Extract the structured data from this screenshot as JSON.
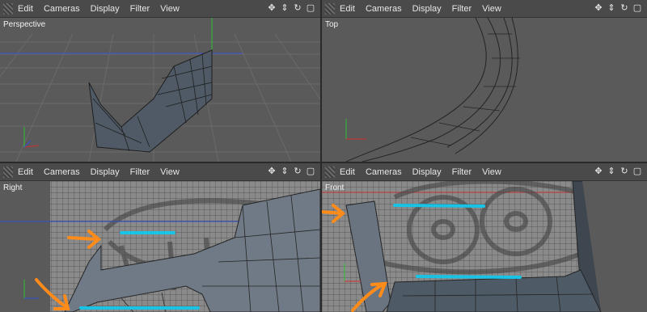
{
  "menu": [
    "Edit",
    "Cameras",
    "Display",
    "Filter",
    "View"
  ],
  "viewports": {
    "perspective": {
      "label": "Perspective"
    },
    "top": {
      "label": "Top"
    },
    "right": {
      "label": "Right"
    },
    "front": {
      "label": "Front"
    }
  },
  "nav_icons": [
    "move-icon",
    "zoom-icon",
    "rotate-icon",
    "maximize-icon"
  ],
  "axes": {
    "x_color": "#d03030",
    "y_color": "#30c030",
    "z_color": "#3050d0"
  },
  "annotation_colors": {
    "arrow": "#ff8c1a",
    "line": "#19c3e6"
  }
}
